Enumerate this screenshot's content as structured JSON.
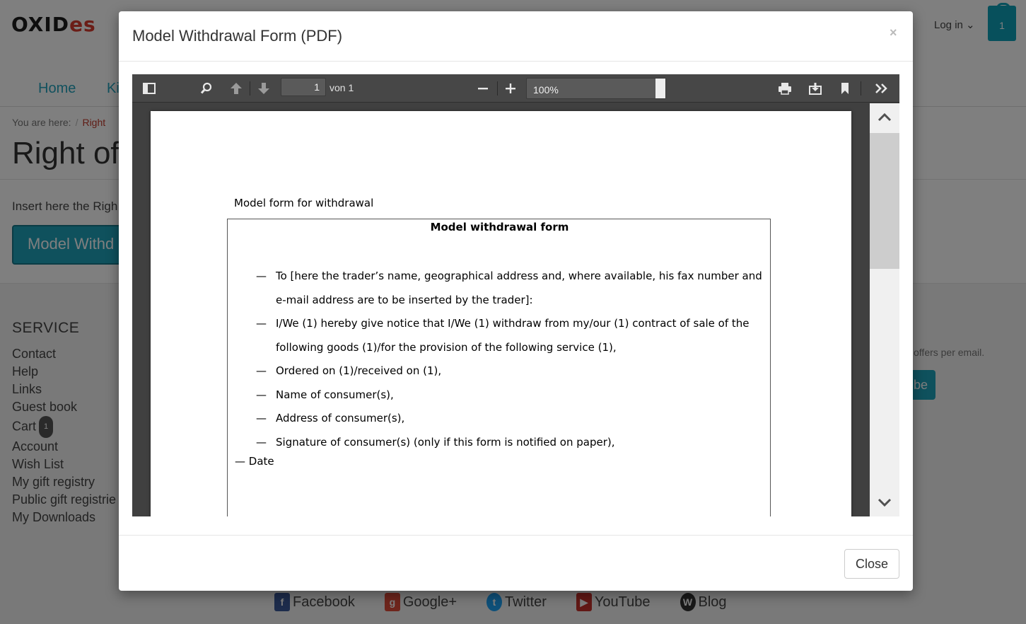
{
  "background": {
    "logo_main": "OXID",
    "logo_accent": "es",
    "login_label": "Log in",
    "cart_count": "1",
    "nav": {
      "home": "Home",
      "partial": "Ki"
    },
    "breadcrumb": {
      "label": "You are here:",
      "separator": "/",
      "item": "Right"
    },
    "page_title": "Right of",
    "intro_text": "Insert here the Righ",
    "model_button_label": "Model Withd",
    "service_title": "SERVICE",
    "service_items": [
      "Contact",
      "Help",
      "Links",
      "Guest book",
      "Cart",
      "Account",
      "Wish List",
      "My gift registry",
      "Public gift registrie",
      "My Downloads"
    ],
    "cart_badge": "1",
    "newsletter_text": "offers per email.",
    "newsletter_button": "be",
    "social": [
      "Facebook",
      "Google+",
      "Twitter",
      "YouTube",
      "Blog"
    ]
  },
  "modal": {
    "title": "Model Withdrawal Form (PDF)",
    "close_x": "×",
    "close_button": "Close"
  },
  "viewer": {
    "page_number": "1",
    "page_of": "von 1",
    "zoom": "100%"
  },
  "pdf": {
    "intro": "Model form for withdrawal",
    "form_title": "Model withdrawal form",
    "items": [
      "To [here the trader’s name, geographical address and, where available, his fax number and e-mail address are to be inserted by the trader]:",
      "I/We (1) hereby give notice that I/We (1) withdraw from my/our (1) contract of sale of the following goods (1)/for the provision of the following service (1),",
      "Ordered on (1)/received on (1),",
      "Name of consumer(s),",
      "Address of consumer(s),",
      "Signature of consumer(s) (only if this form is notified on paper),"
    ],
    "date_label": "— Date"
  },
  "icons": {
    "sidebar_toggle": "sidebar-toggle-icon",
    "find": "search-icon",
    "prev": "arrow-up-icon",
    "next": "arrow-down-icon",
    "zoom_out": "minus-icon",
    "zoom_in": "plus-icon",
    "print": "printer-icon",
    "download": "download-icon",
    "bookmark": "bookmark-icon",
    "tools": "double-chevron-right-icon"
  },
  "colors": {
    "accent": "#1ea2bb",
    "breadcrumb_active": "#c0392b",
    "viewer_bg": "#404040",
    "toolbar_bg": "#474747"
  }
}
